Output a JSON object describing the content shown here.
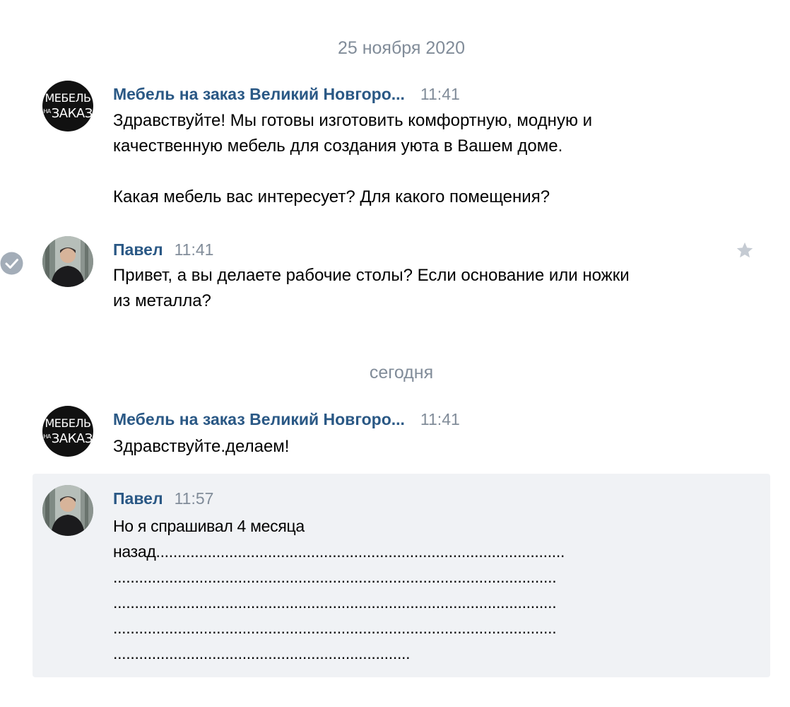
{
  "colors": {
    "author": "#2a5885",
    "meta": "#818c99",
    "highlight": "#f0f2f5"
  },
  "date_separators": [
    "25 ноября 2020",
    "сегодня"
  ],
  "brand_avatar": {
    "line1": "МЕБЕЛЬ",
    "small": "НА",
    "line2": "ЗАКАЗ"
  },
  "messages": [
    {
      "author": "Мебель на заказ Великий Новгоро...",
      "time": "11:41",
      "text": "Здравствуйте! Мы готовы изготовить комфортную, модную и\nкачественную мебель для создания уюта в Вашем доме.\n\nКакая мебель вас интересует? Для какого помещения?",
      "avatar_icon": "brand-logo"
    },
    {
      "author": "Павел",
      "time": "11:41",
      "text": "Привет, а вы делаете рабочие столы? Если основание или ножки\nиз металла?",
      "avatar_icon": "user-photo",
      "status_icon": "read-check-icon",
      "action_icon": "star-icon"
    },
    {
      "author": "Мебель на заказ Великий Новгоро...",
      "time": "11:41",
      "text": "Здравствуйте.делаем!",
      "avatar_icon": "brand-logo"
    },
    {
      "author": "Павел",
      "time": "11:57",
      "text": "Но я спрашивал 4 месяца\nназад...............................................................................................\n.......................................................................................................\n.......................................................................................................\n.......................................................................................................\n.....................................................................",
      "avatar_icon": "user-photo"
    }
  ]
}
